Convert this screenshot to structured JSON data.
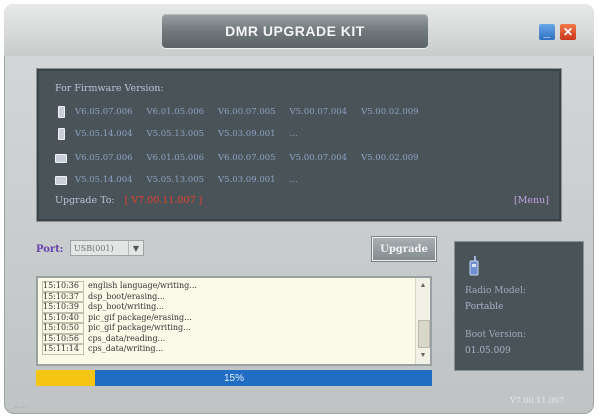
{
  "window": {
    "title": "DMR UPGRADE KIT",
    "minimize_glyph": "_",
    "close_glyph": "✕"
  },
  "firmware": {
    "heading": "For Firmware Version:",
    "rows": [
      {
        "device": "portable-icon",
        "versions": [
          "V6.05.07.006",
          "V6.01.05.006",
          "V6.00.07.005",
          "V5.00.07.004",
          "V5.00.02.009"
        ]
      },
      {
        "device": "portable-icon",
        "versions": [
          "V5.05.14.004",
          "V5.05.13.005",
          "V5.03.09.001",
          "..."
        ]
      },
      {
        "device": "mobile-icon",
        "versions": [
          "V6.05.07.006",
          "V6.01.05.006",
          "V6.00.07.005",
          "V5.00.07.004",
          "V5.00.02.009"
        ]
      },
      {
        "device": "mobile-icon",
        "versions": [
          "V5.05.14.004",
          "V5.05.13.005",
          "V5.03.09.001",
          "..."
        ]
      }
    ],
    "upgrade_to_label": "Upgrade To:",
    "upgrade_to_value": "[ V7.00.11.007 ]",
    "menu_label": "[Menu]"
  },
  "port": {
    "label": "Port:",
    "selected": "USB(001)"
  },
  "upgrade_button": "Upgrade",
  "log": [
    {
      "ts": "15:10:36",
      "msg": "english language/writing..."
    },
    {
      "ts": "15:10:37",
      "msg": "dsp_boot/erasing..."
    },
    {
      "ts": "15:10:39",
      "msg": "dsp_boot/writing..."
    },
    {
      "ts": "15:10:40",
      "msg": "pic_gif package/erasing..."
    },
    {
      "ts": "15:10:50",
      "msg": "pic_gif package/writing..."
    },
    {
      "ts": "15:10:56",
      "msg": "cps_data/reading..."
    },
    {
      "ts": "15:11:14",
      "msg": "cps_data/writing..."
    }
  ],
  "progress": {
    "percent": 15,
    "text": "15%"
  },
  "info": {
    "radio_model_label": "Radio Model:",
    "radio_model_value": "Portable",
    "boot_version_label": "Boot Version:",
    "boot_version_value": "01.05.009"
  },
  "footer": {
    "version": "V7.00.11.007"
  },
  "colors": {
    "panel": "#4a5458",
    "progress_bar": "#1f6ec4",
    "progress_fill": "#f4c512",
    "accent_red": "#e8402c"
  }
}
